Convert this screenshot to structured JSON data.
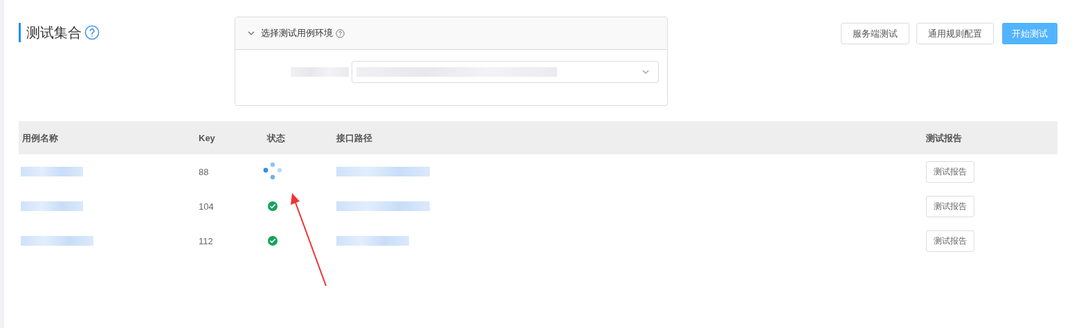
{
  "title": "测试集合",
  "env_panel": {
    "title": "选择测试用例环境",
    "expanded": true
  },
  "buttons": [
    {
      "label": "服务端测试",
      "kind": "default"
    },
    {
      "label": "通用规则配置",
      "kind": "default"
    },
    {
      "label": "开始测试",
      "kind": "primary"
    }
  ],
  "table": {
    "columns": [
      "用例名称",
      "Key",
      "状态",
      "接口路径",
      "测试报告"
    ],
    "rows": [
      {
        "key": "88",
        "kind": "loading",
        "report": "测试报告"
      },
      {
        "key": "104",
        "kind": "success",
        "report": "测试报告"
      },
      {
        "key": "112",
        "kind": "success",
        "report": "测试报告"
      }
    ]
  }
}
